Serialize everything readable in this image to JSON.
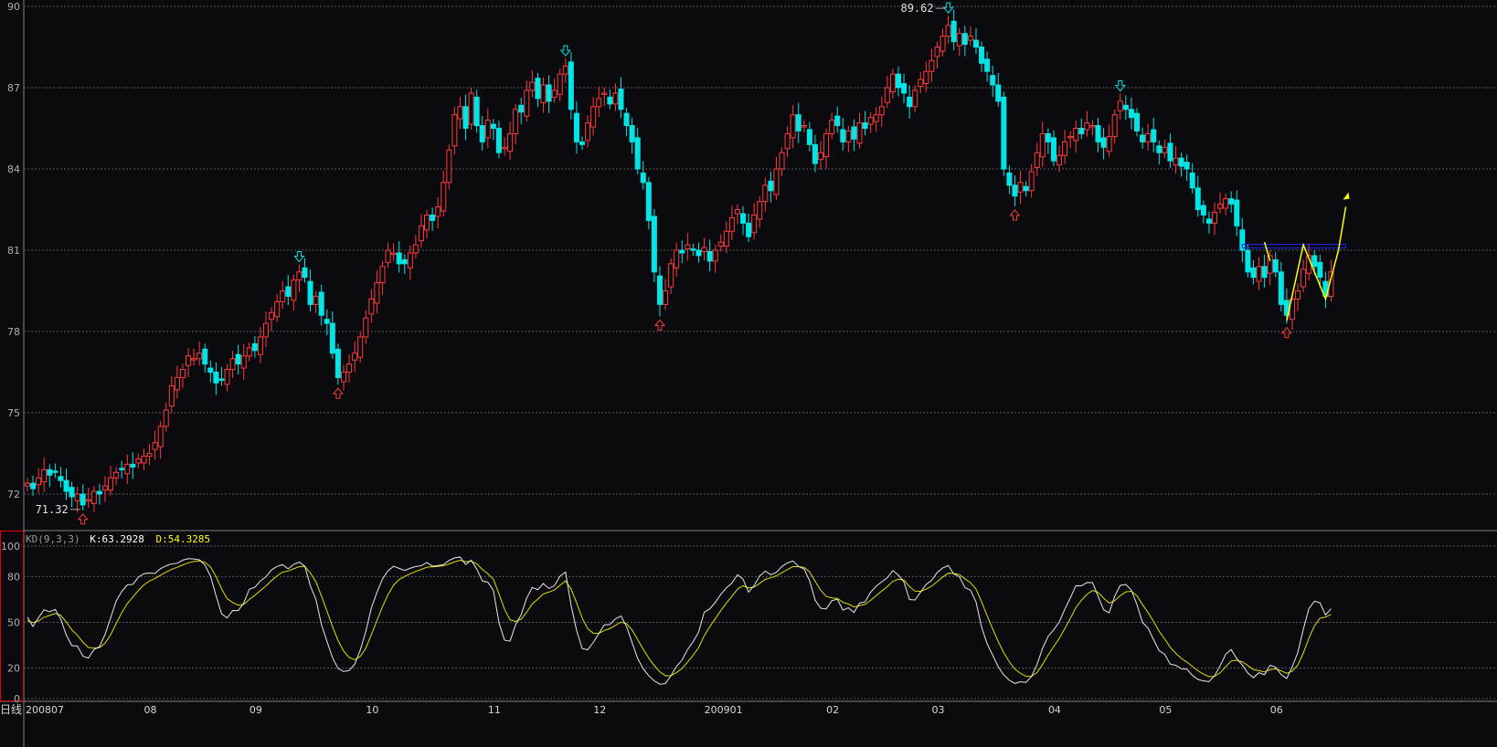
{
  "chart_data": [
    {
      "type": "candlestick",
      "price_axis": {
        "ticks": [
          90,
          87,
          84,
          81,
          78,
          75,
          72
        ],
        "range": [
          71.0,
          90.2
        ]
      },
      "colors": {
        "up": "#ff3b3b",
        "down": "#00e5e5",
        "grid": "#5a5a5a"
      },
      "x_ticks": [
        {
          "label": "200807",
          "index": 0
        },
        {
          "label": "08",
          "index": 22
        },
        {
          "label": "09",
          "index": 41
        },
        {
          "label": "10",
          "index": 62
        },
        {
          "label": "11",
          "index": 84
        },
        {
          "label": "12",
          "index": 103
        },
        {
          "label": "200901",
          "index": 123
        },
        {
          "label": "02",
          "index": 145
        },
        {
          "label": "03",
          "index": 164
        },
        {
          "label": "04",
          "index": 185
        },
        {
          "label": "05",
          "index": 205
        },
        {
          "label": "06",
          "index": 225
        }
      ],
      "close": [
        72.4,
        72.2,
        72.6,
        72.9,
        72.7,
        72.8,
        72.5,
        72.1,
        71.9,
        72.0,
        71.6,
        71.8,
        72.1,
        72.0,
        72.3,
        72.6,
        72.8,
        72.9,
        73.1,
        73.0,
        73.3,
        73.4,
        73.5,
        73.9,
        74.5,
        75.1,
        76.0,
        76.3,
        76.6,
        77.1,
        77.0,
        77.2,
        76.8,
        76.5,
        76.1,
        76.2,
        76.6,
        77.0,
        76.8,
        77.1,
        77.4,
        77.3,
        77.8,
        78.3,
        78.7,
        79.1,
        79.5,
        79.3,
        79.9,
        80.2,
        80.0,
        79.0,
        79.3,
        78.6,
        78.3,
        77.2,
        76.3,
        76.5,
        76.8,
        77.2,
        77.8,
        78.5,
        79.2,
        79.8,
        80.4,
        81.0,
        80.9,
        80.5,
        80.5,
        80.9,
        81.2,
        81.9,
        82.3,
        82.1,
        82.6,
        83.5,
        84.7,
        86.0,
        86.3,
        85.5,
        86.8,
        85.6,
        85.0,
        85.8,
        85.5,
        84.6,
        84.8,
        85.3,
        86.2,
        86.1,
        86.9,
        87.2,
        86.6,
        87.1,
        86.5,
        86.9,
        87.5,
        87.8,
        86.2,
        85.0,
        84.9,
        85.7,
        86.3,
        86.6,
        86.8,
        86.4,
        86.8,
        86.2,
        85.6,
        85.0,
        84.0,
        83.5,
        82.1,
        80.2,
        79.0,
        79.5,
        80.5,
        81.0,
        80.9,
        81.2,
        81.0,
        80.8,
        81.1,
        80.6,
        81.0,
        81.3,
        81.7,
        82.2,
        82.5,
        82.0,
        81.5,
        82.3,
        82.8,
        83.4,
        83.2,
        84.0,
        84.6,
        85.3,
        86.0,
        85.4,
        85.6,
        84.9,
        84.2,
        84.6,
        85.3,
        85.8,
        85.6,
        85.0,
        85.4,
        85.1,
        85.7,
        85.5,
        85.9,
        86.0,
        86.3,
        87.0,
        87.5,
        87.0,
        86.8,
        86.3,
        86.9,
        87.3,
        87.6,
        88.0,
        88.5,
        88.9,
        89.3,
        88.7,
        89.0,
        88.6,
        88.9,
        88.5,
        87.9,
        87.6,
        87.1,
        86.5,
        84.0,
        83.4,
        83.0,
        83.5,
        83.2,
        83.9,
        84.6,
        85.3,
        85.0,
        84.3,
        84.5,
        85.0,
        85.2,
        85.5,
        85.3,
        85.7,
        85.6,
        85.0,
        84.8,
        85.2,
        86.0,
        86.5,
        86.2,
        85.9,
        85.4,
        85.0,
        85.3,
        85.0,
        84.6,
        84.8,
        84.3,
        84.4,
        84.1,
        84.0,
        83.3,
        82.5,
        82.3,
        82.0,
        82.4,
        82.7,
        82.9,
        82.7,
        81.9,
        81.0,
        80.2,
        80.0,
        80.4,
        80.0,
        80.8,
        80.2,
        79.0,
        78.6,
        79.2,
        79.5,
        80.3,
        80.8,
        80.4,
        80.0,
        79.3,
        80.2
      ],
      "markers": [
        {
          "type": "low",
          "index": 10,
          "label": "71.32"
        },
        {
          "type": "high",
          "index": 49
        },
        {
          "type": "low",
          "index": 56
        },
        {
          "type": "high",
          "index": 97
        },
        {
          "type": "low",
          "index": 114
        },
        {
          "type": "high",
          "index": 166,
          "label": "89.62"
        },
        {
          "type": "low",
          "index": 178
        },
        {
          "type": "high",
          "index": 197
        },
        {
          "type": "low",
          "index": 227
        }
      ],
      "annotation_color": "#ffff00"
    },
    {
      "type": "line",
      "indicator": "KD(9,3,3)",
      "header": {
        "name": "KD(9,3,3)",
        "k_text": "K:63.2928",
        "d_text": "D:54.3285"
      },
      "y_ticks": [
        100,
        80,
        50,
        20,
        0
      ],
      "ylim": [
        0,
        100
      ],
      "series": [
        {
          "name": "K",
          "last": 63.2928,
          "color": "#e8e8e8"
        },
        {
          "name": "D",
          "last": 54.3285,
          "color": "#e0e000"
        }
      ]
    }
  ],
  "footer": {
    "period_label": "日线"
  }
}
